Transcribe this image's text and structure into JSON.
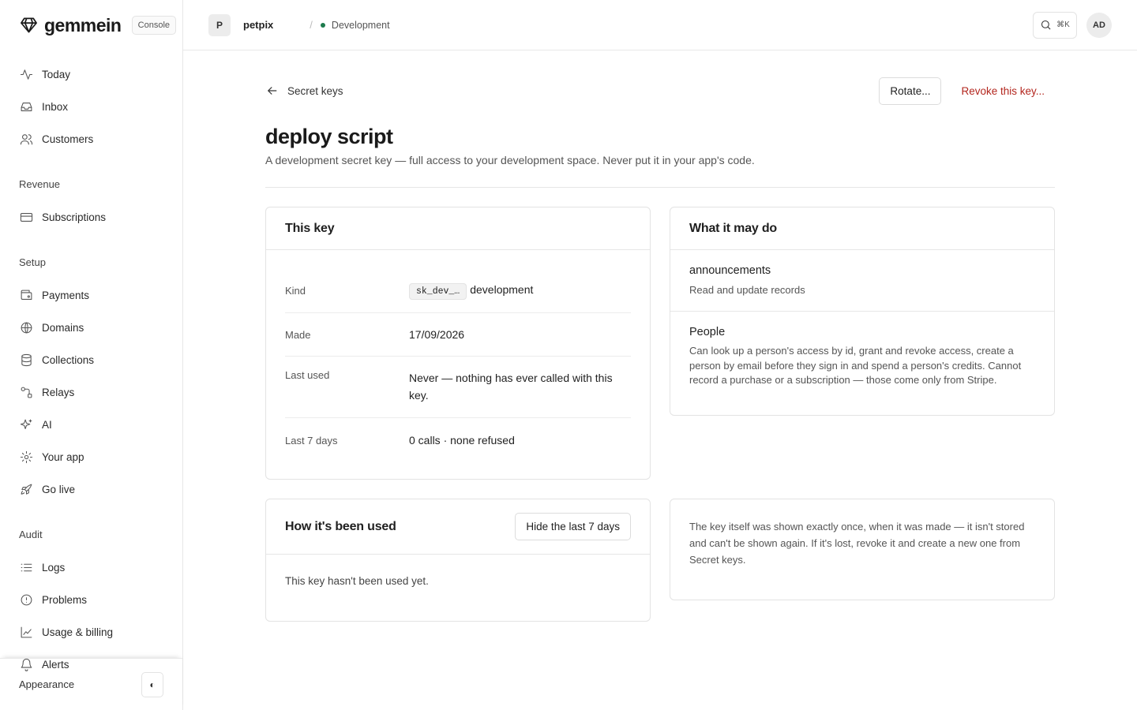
{
  "sidebar": {
    "brand_name": "gemmein",
    "console_label": "Console",
    "primary": [
      {
        "label": "Today",
        "icon": "activity-icon"
      },
      {
        "label": "Inbox",
        "icon": "inbox-icon"
      },
      {
        "label": "Customers",
        "icon": "users-icon"
      }
    ],
    "revenue_label": "Revenue",
    "revenue": [
      {
        "label": "Subscriptions",
        "icon": "credit-card-icon"
      }
    ],
    "setup_label": "Setup",
    "setup": [
      {
        "label": "Payments",
        "icon": "wallet-icon"
      },
      {
        "label": "Domains",
        "icon": "globe-icon"
      },
      {
        "label": "Collections",
        "icon": "database-icon"
      },
      {
        "label": "Relays",
        "icon": "relay-icon"
      },
      {
        "label": "AI",
        "icon": "sparkles-icon"
      },
      {
        "label": "Your app",
        "icon": "gear-icon"
      },
      {
        "label": "Go live",
        "icon": "rocket-icon"
      }
    ],
    "audit_label": "Audit",
    "audit": [
      {
        "label": "Logs",
        "icon": "list-icon"
      },
      {
        "label": "Problems",
        "icon": "alert-circle-icon"
      },
      {
        "label": "Usage & billing",
        "icon": "chart-icon"
      },
      {
        "label": "Alerts",
        "icon": "bell-icon"
      }
    ],
    "appearance_label": "Appearance",
    "appearance_toggle": "◐"
  },
  "topbar": {
    "project_initial": "P",
    "project_name": "petpix",
    "separator": "/",
    "environment": "Development",
    "search_shortcut": "⌘K",
    "avatar_initials": "AD"
  },
  "page": {
    "back_label": "Secret keys",
    "rotate_label": "Rotate...",
    "revoke_label": "Revoke this key...",
    "title": "deploy script",
    "subtitle": "A development secret key — full access to your development space. Never put it in your app's code."
  },
  "this_key": {
    "heading": "This key",
    "kind_label": "Kind",
    "kind_prefix": "sk_dev_…",
    "kind_value": "development",
    "made_label": "Made",
    "made_value": "17/09/2026",
    "last_used_label": "Last used",
    "last_used_value": "Never — nothing has ever called with this key.",
    "last7_label": "Last 7 days",
    "last7_value": "0 calls · none refused"
  },
  "permissions": {
    "heading": "What it may do",
    "items": [
      {
        "title": "announcements",
        "desc": "Read and update records"
      },
      {
        "title": "People",
        "desc": "Can look up a person's access by id, grant and revoke access, create a person by email before they sign in and spend a person's credits. Cannot record a purchase or a subscription — those come only from Stripe."
      }
    ]
  },
  "usage": {
    "heading": "How it's been used",
    "hide_button": "Hide the last 7 days",
    "empty_text": "This key hasn't been used yet."
  },
  "note": {
    "text": "The key itself was shown exactly once, when it was made — it isn't stored and can't be shown again. If it's lost, revoke it and create a new one from Secret keys."
  },
  "colors": {
    "danger": "#b3261e",
    "env_dot": "#1e7b4d"
  }
}
